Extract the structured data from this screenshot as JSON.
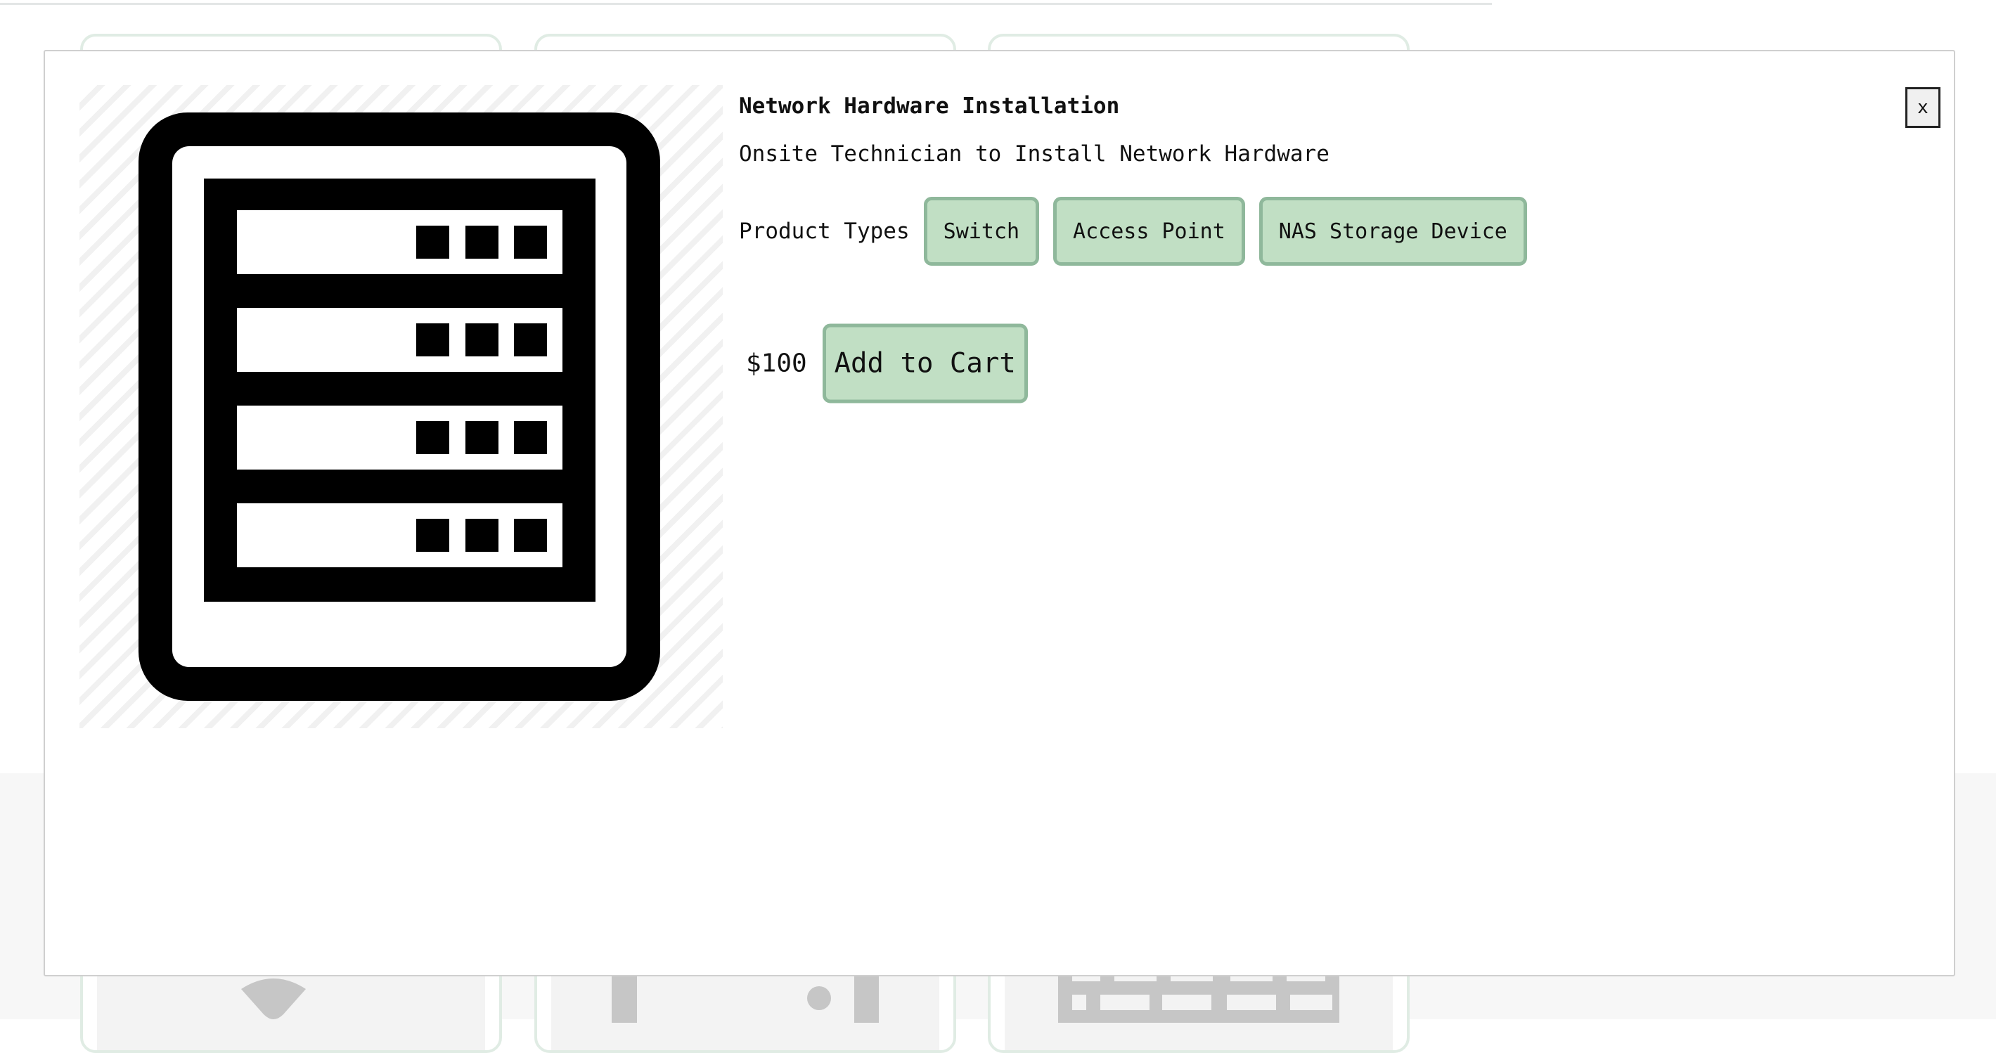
{
  "modal": {
    "image_icon": "server-rack-icon",
    "title": "Network Hardware Installation",
    "description": "Onsite Technician to Install Network Hardware",
    "product_types_label": "Product Types",
    "product_types": [
      "Switch",
      "Access Point",
      "NAS Storage Device"
    ],
    "price": "$100",
    "add_to_cart_label": "Add to Cart",
    "close_label": "x"
  },
  "background": {
    "cards": [
      {
        "icon": "wifi-icon"
      },
      {
        "icon": "network-switch-icon"
      },
      {
        "icon": "keyboard-icon"
      }
    ]
  },
  "colors": {
    "chip_fill": "#c1dfc4",
    "chip_border": "#8fb89b",
    "modal_border": "#cfcfcf"
  }
}
